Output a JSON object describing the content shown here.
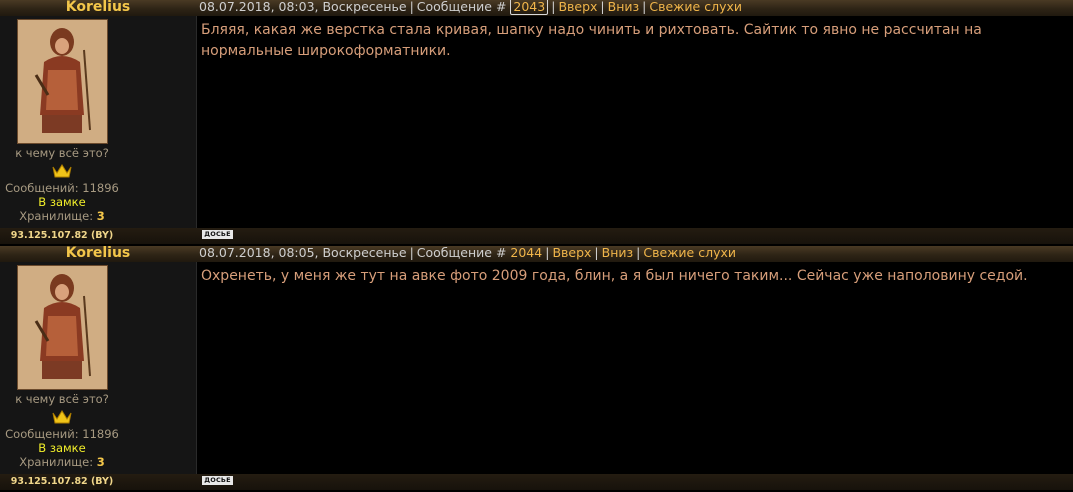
{
  "posts": [
    {
      "author": "Korelius",
      "date": "08.07.2018, 08:03, Воскресенье",
      "msg_label": "Сообщение #",
      "msg_number": "2043",
      "up_label": "Вверх",
      "down_label": "Вниз",
      "rumors_label": "Свежие слухи",
      "tagline": "к чему всё это?",
      "posts_count": "Сообщений: 11896",
      "status": "В замке",
      "storage_label": "Хранилище:",
      "storage_value": "3",
      "ip": "93.125.107.82 (BY)",
      "dossier": "ДОСЬЕ",
      "text": "Бляяя, какая же верстка стала кривая, шапку надо чинить и рихтовать. Сайтик то явно не рассчитан на нормальные широкоформатники."
    },
    {
      "author": "Korelius",
      "date": "08.07.2018, 08:05, Воскресенье",
      "msg_label": "Сообщение #",
      "msg_number": "2044",
      "up_label": "Вверх",
      "down_label": "Вниз",
      "rumors_label": "Свежие слухи",
      "tagline": "к чему всё это?",
      "posts_count": "Сообщений: 11896",
      "status": "В замке",
      "storage_label": "Хранилище:",
      "storage_value": "3",
      "ip": "93.125.107.82 (BY)",
      "dossier": "ДОСЬЕ",
      "text": "Охренеть, у меня же тут на авке фото 2009 года, блин, а я был ничего таким... Сейчас уже наполовину седой."
    }
  ],
  "colors": {
    "nick": "#f3c64a",
    "link": "#f0b54a",
    "body_text": "#d79e7a",
    "status_online": "#f2ef2a"
  },
  "icons": {
    "rank": "crown-icon"
  }
}
